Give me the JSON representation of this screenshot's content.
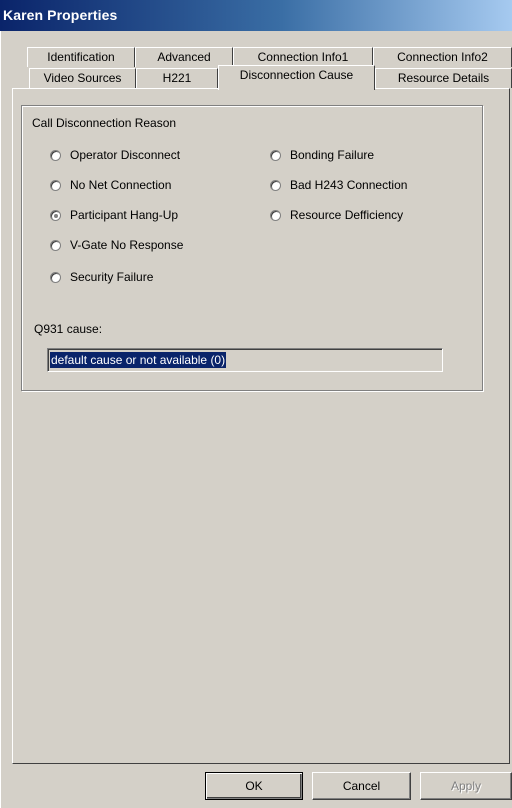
{
  "window": {
    "title": "Karen Properties"
  },
  "tabs": {
    "row1": [
      {
        "label": "Identification"
      },
      {
        "label": "Advanced"
      },
      {
        "label": "Connection Info1"
      },
      {
        "label": "Connection Info2"
      }
    ],
    "row2": [
      {
        "label": "Video Sources"
      },
      {
        "label": "H221"
      },
      {
        "label": "Disconnection Cause",
        "active": true
      },
      {
        "label": "Resource Details"
      }
    ]
  },
  "group": {
    "title": "Call Disconnection Reason",
    "radios": [
      {
        "label": "Operator Disconnect",
        "checked": false
      },
      {
        "label": "No Net Connection",
        "checked": false
      },
      {
        "label": "Participant Hang-Up",
        "checked": true
      },
      {
        "label": "V-Gate No Response",
        "checked": false
      },
      {
        "label": "Security Failure",
        "checked": false
      },
      {
        "label": "Bonding Failure",
        "checked": false
      },
      {
        "label": "Bad H243 Connection",
        "checked": false
      },
      {
        "label": "Resource Defficiency",
        "checked": false
      }
    ],
    "q931_label": "Q931 cause:",
    "q931_value": "default cause or not available (0)"
  },
  "buttons": {
    "ok": "OK",
    "cancel": "Cancel",
    "apply": "Apply"
  }
}
